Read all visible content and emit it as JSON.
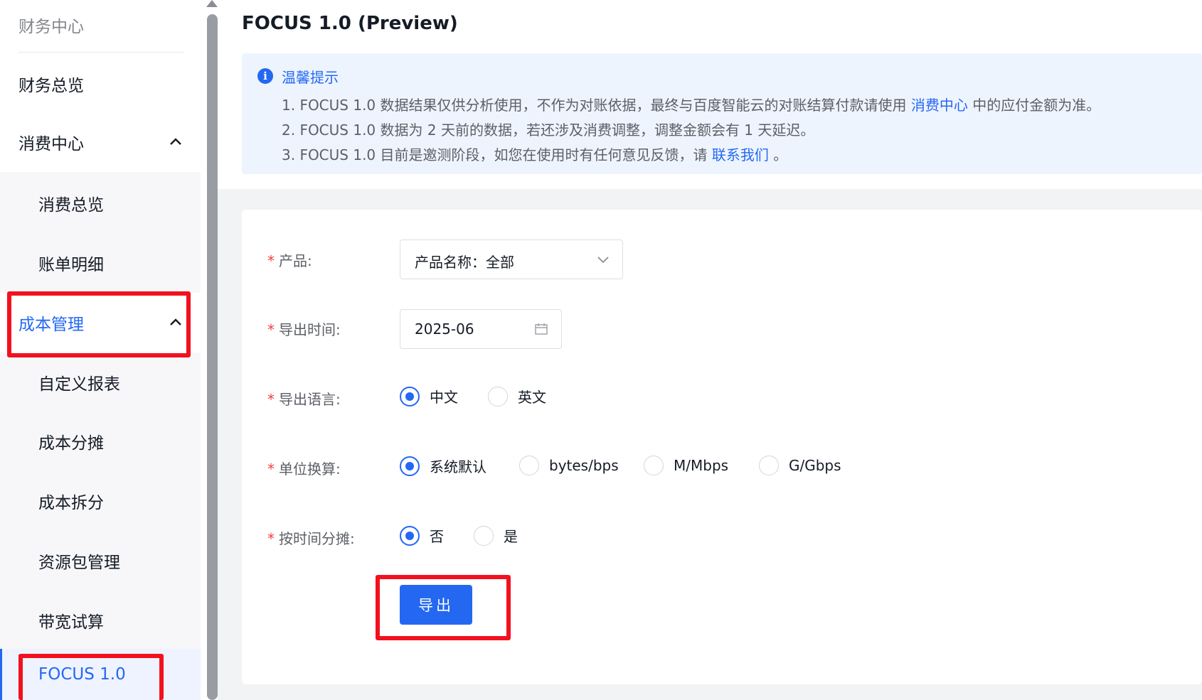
{
  "sidebar": {
    "title": "财务中心",
    "items": [
      {
        "label": "财务总览"
      },
      {
        "label": "消费中心"
      },
      {
        "label": "消费总览"
      },
      {
        "label": "账单明细"
      },
      {
        "label": "成本管理"
      },
      {
        "label": "自定义报表"
      },
      {
        "label": "成本分摊"
      },
      {
        "label": "成本拆分"
      },
      {
        "label": "资源包管理"
      },
      {
        "label": "带宽试算"
      },
      {
        "label": "FOCUS 1.0"
      }
    ]
  },
  "page": {
    "title": "FOCUS 1.0 (Preview)"
  },
  "notice": {
    "title": "温馨提示",
    "line1_pre": "1.  FOCUS 1.0 数据结果仅供分析使用，不作为对账依据，最终与百度智能云的对账结算付款请使用 ",
    "line1_link": "消费中心",
    "line1_post": " 中的应付金额为准。",
    "line2": "2.  FOCUS 1.0 数据为 2 天前的数据，若还涉及消费调整，调整金额会有 1 天延迟。",
    "line3_pre": "3.  FOCUS 1.0 目前是邀测阶段，如您在使用时有任何意见反馈，请 ",
    "line3_link": "联系我们",
    "line3_post": " 。"
  },
  "form": {
    "required_mark": "*",
    "product_label": "产品:",
    "product_value": "产品名称：全部",
    "time_label": "导出时间:",
    "time_value": "2025-06",
    "language_label": "导出语言:",
    "language_options": [
      {
        "label": "中文",
        "checked": true
      },
      {
        "label": "英文",
        "checked": false
      }
    ],
    "unit_label": "单位换算:",
    "unit_options": [
      {
        "label": "系统默认",
        "checked": true
      },
      {
        "label": "bytes/bps",
        "checked": false
      },
      {
        "label": "M/Mbps",
        "checked": false
      },
      {
        "label": "G/Gbps",
        "checked": false
      }
    ],
    "split_label": "按时间分摊:",
    "split_options": [
      {
        "label": "否",
        "checked": true
      },
      {
        "label": "是",
        "checked": false
      }
    ],
    "export_button": "导出"
  },
  "colors": {
    "accent": "#2468f2",
    "highlight": "#f2111e"
  }
}
